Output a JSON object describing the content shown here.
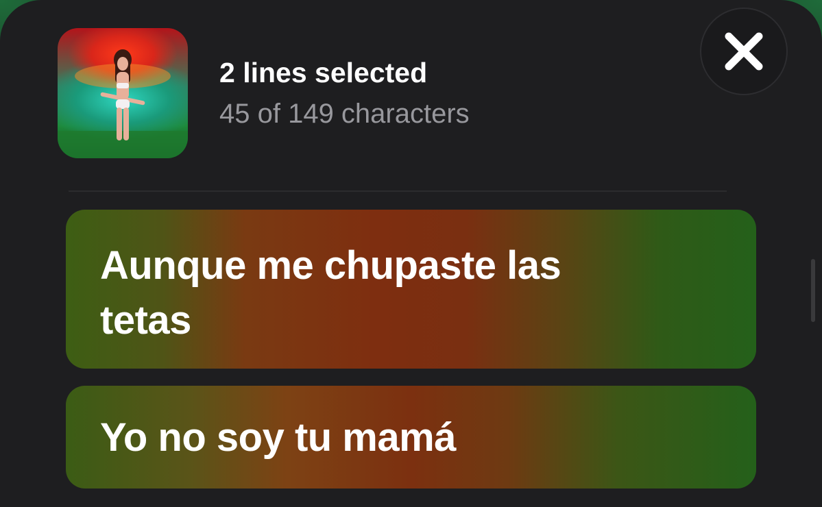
{
  "header": {
    "title": "2 lines selected",
    "subtitle": "45 of 149 characters",
    "artwork_icon": "album-artwork",
    "close_icon": "close-icon"
  },
  "lyrics": [
    {
      "text": "Aunque me chupaste las tetas"
    },
    {
      "text": "Yo no soy tu mamá"
    }
  ],
  "colors": {
    "sheet_background": "#1e1e20",
    "title": "#ffffff",
    "subtitle": "#98989d",
    "card_green": "#2f5a17",
    "card_red": "#7e2e10"
  }
}
